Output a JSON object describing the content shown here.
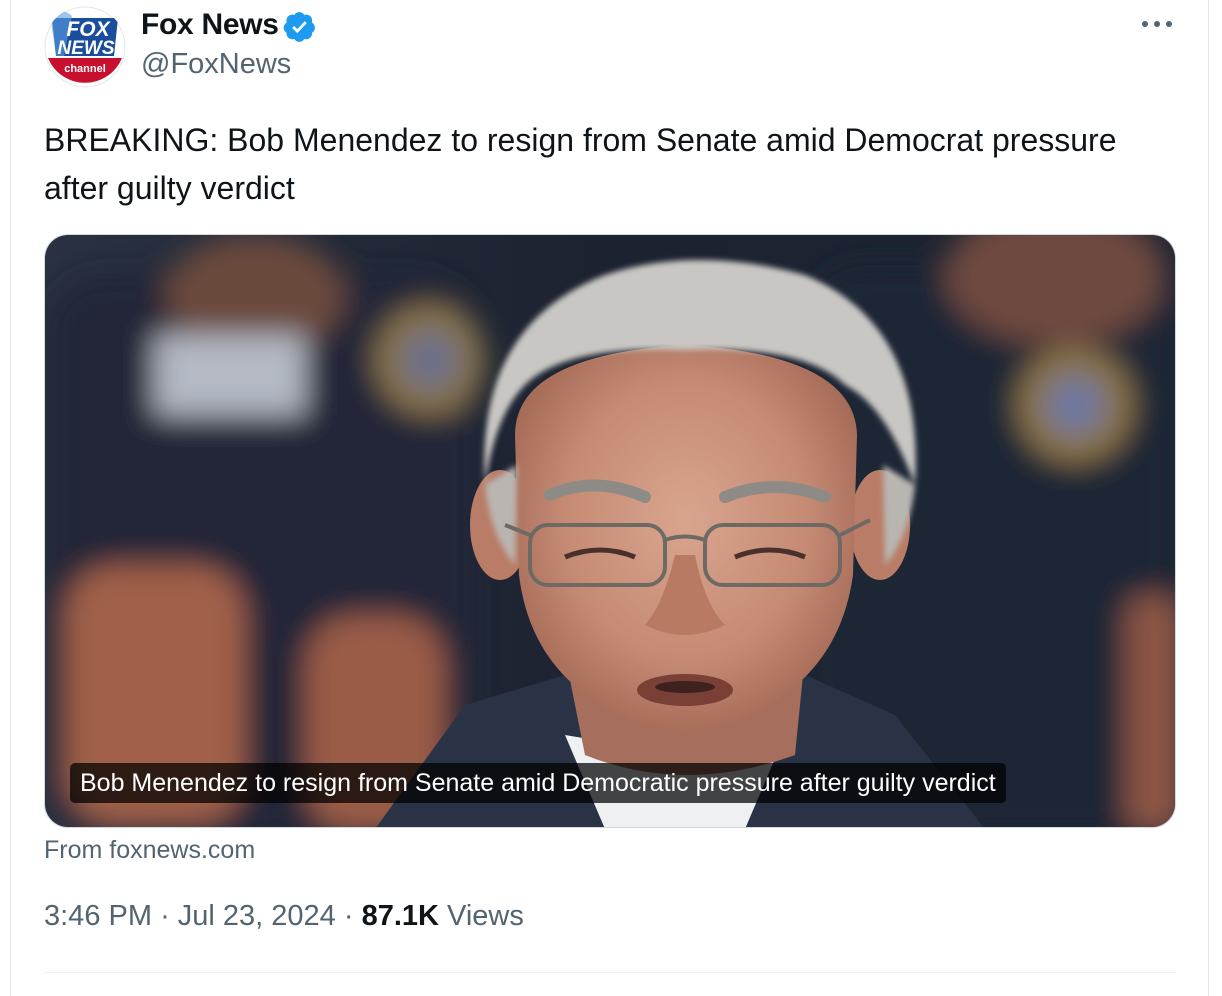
{
  "author": {
    "name": "Fox News",
    "handle": "@FoxNews",
    "verified": true,
    "avatar_icon": "fox-news-channel-logo",
    "avatar_text": [
      "FOX",
      "NEWS",
      "channel"
    ]
  },
  "tweet": {
    "text": "BREAKING: Bob Menendez to resign from Senate amid Democrat pressure after guilty verdict",
    "media_caption": "Bob Menendez to resign from Senate amid Democratic pressure after guilty verdict",
    "source": "From foxnews.com",
    "time": "3:46 PM",
    "date": "Jul 23, 2024",
    "views_count": "87.1K",
    "views_label": "Views"
  },
  "icons": {
    "verified": "verified-badge-icon",
    "more": "more-options-icon"
  },
  "colors": {
    "verified_blue": "#1d9bf0",
    "secondary_text": "#536471",
    "fox_blue": "#1a4d9c",
    "fox_red": "#c8102e"
  }
}
